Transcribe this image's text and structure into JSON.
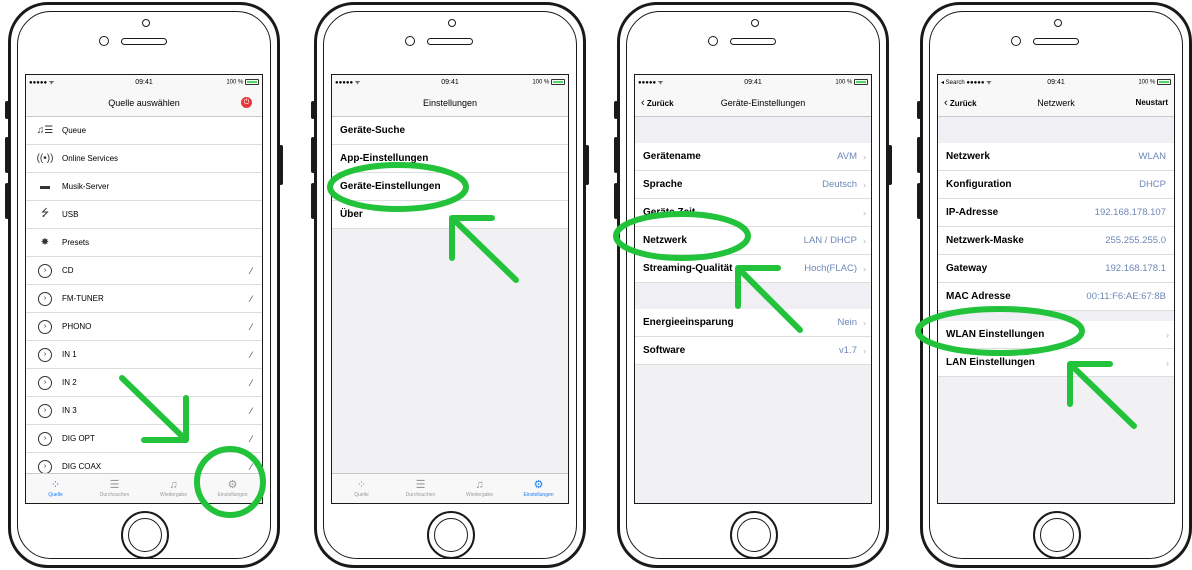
{
  "phones": [
    {
      "status": {
        "carrier": "●●●●● ᯤ",
        "time": "09:41",
        "battery": "100 %"
      },
      "nav_title": "Quelle auswählen",
      "sources": [
        {
          "icon": "queue-icon",
          "glyph": "♫☰",
          "label": "Queue"
        },
        {
          "icon": "online-services-icon",
          "glyph": "((•))",
          "label": "Online Services"
        },
        {
          "icon": "music-server-icon",
          "glyph": "▬",
          "label": "Musik-Server"
        },
        {
          "icon": "usb-icon",
          "glyph": "⭍",
          "label": "USB"
        },
        {
          "icon": "presets-icon",
          "glyph": "✸",
          "label": "Presets"
        }
      ],
      "inputs": [
        "CD",
        "FM-TUNER",
        "PHONO",
        "IN 1",
        "IN 2",
        "IN 3",
        "DIG OPT",
        "DIG COAX"
      ],
      "tabs": [
        {
          "icon": "quelle-icon",
          "glyph": "⁘",
          "label": "Quelle",
          "active": true
        },
        {
          "icon": "durchsuchen-icon",
          "glyph": "☰",
          "label": "Durchsuchen",
          "active": false
        },
        {
          "icon": "wiedergabe-icon",
          "glyph": "♫",
          "label": "Wiedergabe",
          "active": false
        },
        {
          "icon": "einstellungen-icon",
          "glyph": "⚙",
          "label": "Einstellungen",
          "active": false
        }
      ]
    },
    {
      "status": {
        "carrier": "●●●●● ᯤ",
        "time": "09:41",
        "battery": "100 %"
      },
      "nav_title": "Einstellungen",
      "rows": [
        "Geräte-Suche",
        "App-Einstellungen",
        "Geräte-Einstellungen",
        "Über"
      ],
      "tabs": [
        {
          "icon": "quelle-icon",
          "glyph": "⁘",
          "label": "Quelle",
          "active": false
        },
        {
          "icon": "durchsuchen-icon",
          "glyph": "☰",
          "label": "Durchsuchen",
          "active": false
        },
        {
          "icon": "wiedergabe-icon",
          "glyph": "♫",
          "label": "Wiedergabe",
          "active": false
        },
        {
          "icon": "einstellungen-icon",
          "glyph": "⚙",
          "label": "Einstellungen",
          "active": true
        }
      ]
    },
    {
      "status": {
        "carrier": "●●●●● ᯤ",
        "time": "09:41",
        "battery": "100 %"
      },
      "back_label": "Zurück",
      "nav_title": "Geräte-Einstellungen",
      "group1": [
        {
          "key": "Gerätename",
          "value": "AVM"
        },
        {
          "key": "Sprache",
          "value": "Deutsch"
        },
        {
          "key": "Geräte Zeit",
          "value": ""
        },
        {
          "key": "Netzwerk",
          "value": "LAN / DHCP"
        },
        {
          "key": "Streaming-Qualität",
          "value": "Hoch(FLAC)"
        }
      ],
      "group2": [
        {
          "key": "Energieeinsparung",
          "value": "Nein"
        },
        {
          "key": "Software",
          "value": "v1.7"
        }
      ]
    },
    {
      "status": {
        "carrier": "◂ Search ●●●●● ᯤ",
        "time": "09:41",
        "battery": "100 %"
      },
      "back_label": "Zurück",
      "nav_title": "Netzwerk",
      "right_label": "Neustart",
      "info": [
        {
          "key": "Netzwerk",
          "value": "WLAN"
        },
        {
          "key": "Konfiguration",
          "value": "DHCP"
        },
        {
          "key": "IP-Adresse",
          "value": "192.168.178.107"
        },
        {
          "key": "Netzwerk-Maske",
          "value": "255.255.255.0"
        },
        {
          "key": "Gateway",
          "value": "192.168.178.1"
        },
        {
          "key": "MAC Adresse",
          "value": "00:11:F6:AE:67:8B"
        }
      ],
      "settings": [
        "WLAN Einstellungen",
        "LAN Einstellungen"
      ]
    }
  ],
  "colors": {
    "highlight": "#22c33a",
    "accent": "#1b7bf7",
    "power": "#e5393b"
  }
}
